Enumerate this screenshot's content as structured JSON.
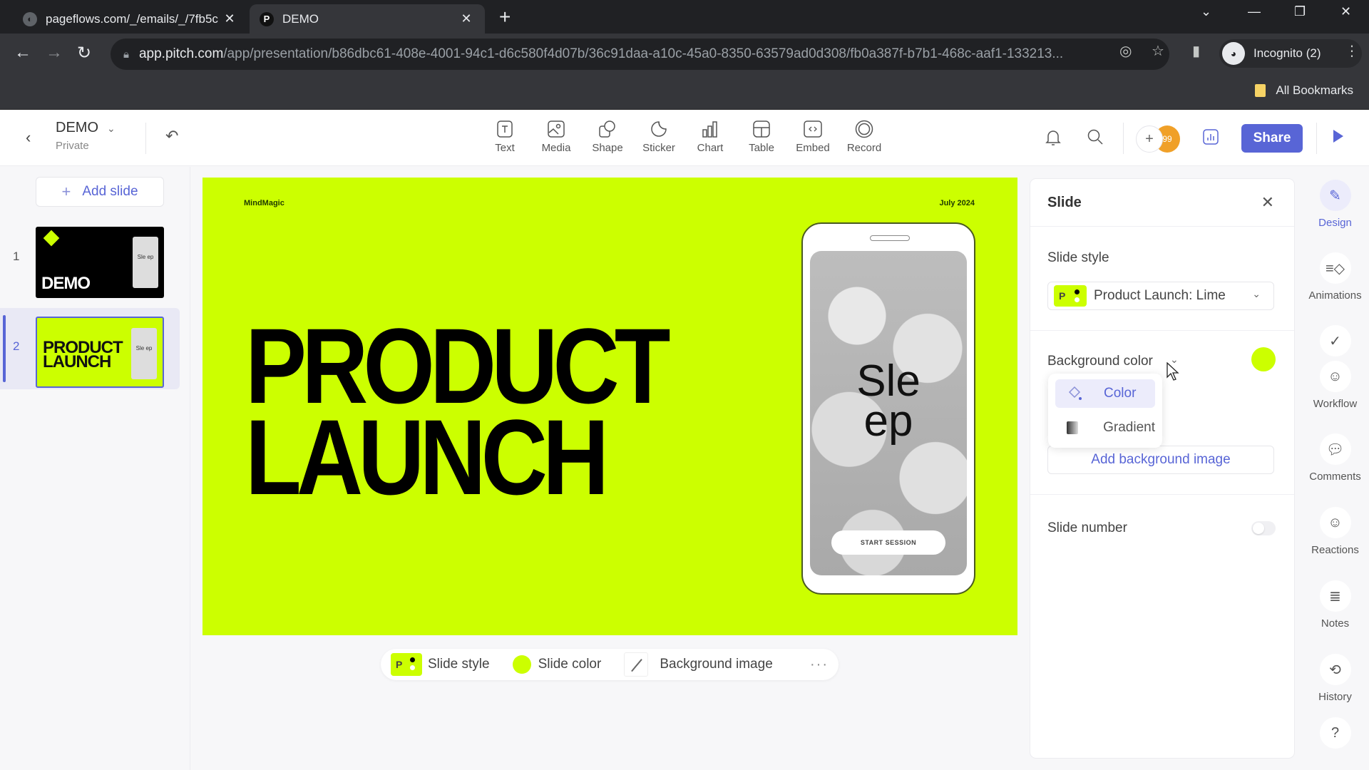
{
  "browser": {
    "tabs": [
      {
        "title": "pageflows.com/_/emails/_/7fb5c",
        "active": false
      },
      {
        "title": "DEMO",
        "active": true
      }
    ],
    "url_host": "app.pitch.com",
    "url_path": "/app/presentation/b86dbc61-408e-4001-94c1-d6c580f4d07b/36c91daa-a10c-45a0-8350-63579ad0d308/fb0a387f-b7b1-468c-aaf1-133213...",
    "profile": "Incognito (2)",
    "bookmarks_label": "All Bookmarks"
  },
  "app": {
    "doc_title": "DEMO",
    "doc_visibility": "Private",
    "tools": [
      {
        "label": "Text",
        "icon": "text-icon"
      },
      {
        "label": "Media",
        "icon": "media-icon"
      },
      {
        "label": "Shape",
        "icon": "shape-icon"
      },
      {
        "label": "Sticker",
        "icon": "sticker-icon"
      },
      {
        "label": "Chart",
        "icon": "chart-icon"
      },
      {
        "label": "Table",
        "icon": "table-icon"
      },
      {
        "label": "Embed",
        "icon": "embed-icon"
      },
      {
        "label": "Record",
        "icon": "record-icon"
      }
    ],
    "share_label": "Share",
    "avatar_initials": "99"
  },
  "sidebar": {
    "add_slide_label": "Add slide",
    "slides": [
      {
        "number": "1",
        "title": "DEMO",
        "phone_text": "Sle ep",
        "selected": false
      },
      {
        "number": "2",
        "title_line1": "PRODUCT",
        "title_line2": "LAUNCH",
        "phone_text": "Sle ep",
        "selected": true
      }
    ]
  },
  "slide": {
    "brand": "MindMagic",
    "date": "July 2024",
    "headline_line1": "PRODUCT",
    "headline_line2": "LAUNCH",
    "phone_line1": "Sle",
    "phone_line2": "ep",
    "phone_button": "START SESSION",
    "background_color": "#ccff00"
  },
  "bottom_bar": {
    "style_badge": "P",
    "slide_style": "Slide style",
    "slide_color": "Slide color",
    "background_image": "Background image",
    "more": "···"
  },
  "panel": {
    "title": "Slide",
    "slide_style_label": "Slide style",
    "slide_style_value": "Product Launch: Lime",
    "style_badge": "P",
    "background_color_label": "Background color",
    "background_color_value": "#ccff00",
    "dropdown_options": [
      {
        "label": "Color",
        "active": true
      },
      {
        "label": "Gradient",
        "active": false
      }
    ],
    "add_background_image": "Add background image",
    "slide_number_label": "Slide number",
    "slide_number_enabled": false
  },
  "rail": {
    "items": [
      {
        "label": "Design",
        "active": true
      },
      {
        "label": "Animations"
      },
      {
        "label": "Workflow"
      },
      {
        "label": "Comments"
      },
      {
        "label": "Reactions"
      },
      {
        "label": "Notes"
      },
      {
        "label": "History"
      }
    ]
  },
  "colors": {
    "accent": "#5865d6",
    "lime": "#ccff00"
  }
}
